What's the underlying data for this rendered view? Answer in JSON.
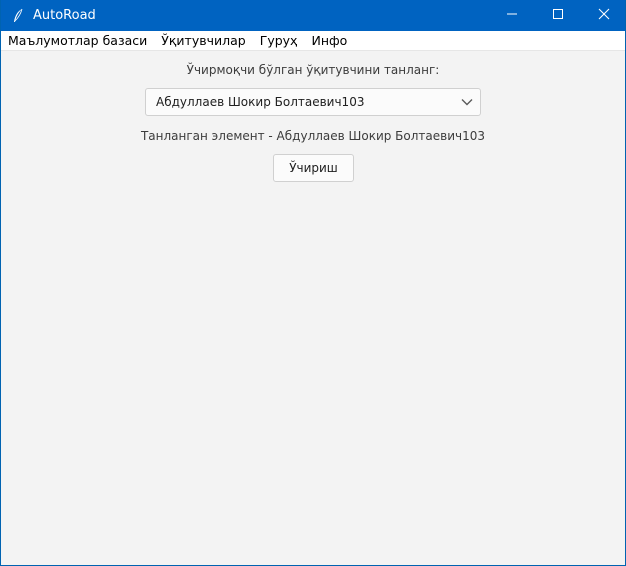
{
  "window": {
    "title": "AutoRoad",
    "controls": {
      "minimize_icon": "minimize-icon",
      "maximize_icon": "maximize-icon",
      "close_icon": "close-icon"
    },
    "accent_color": "#0063c1"
  },
  "menubar": {
    "items": [
      {
        "label": "Маълумотлар базаси"
      },
      {
        "label": "Ўқитувчилар"
      },
      {
        "label": "Гуруҳ"
      },
      {
        "label": "Инфо"
      }
    ]
  },
  "main": {
    "prompt": "Ўчирмоқчи бўлган ўқитувчини танланг:",
    "teacher_select": {
      "value": "Абдуллаев Шокир Болтаевич103",
      "icon": "chevron-down-icon"
    },
    "selected_text": "Танланган элемент - Абдуллаев Шокир Болтаевич103",
    "delete_button": "Ўчириш"
  }
}
